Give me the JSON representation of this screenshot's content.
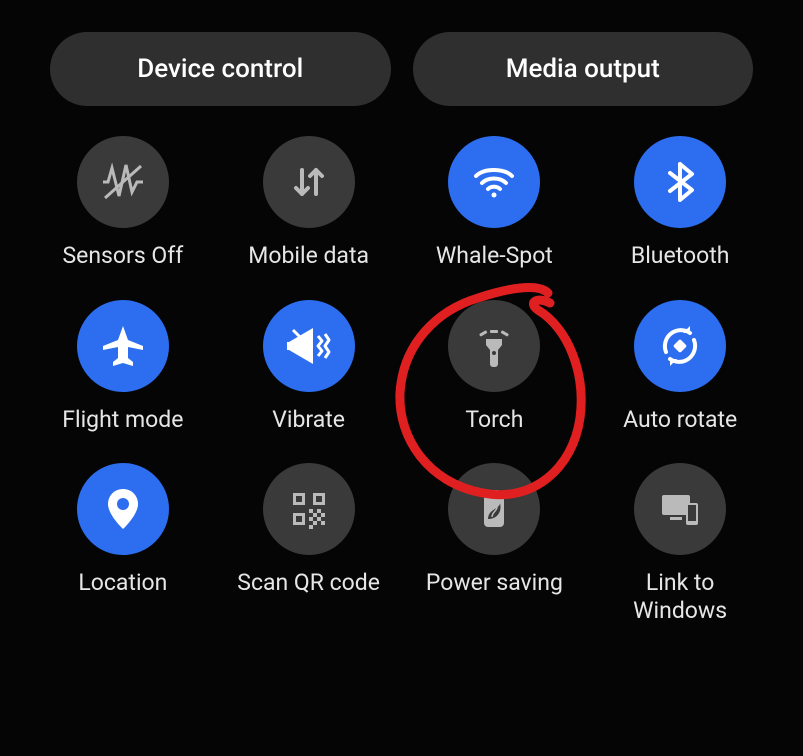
{
  "top": {
    "device_control": "Device control",
    "media_output": "Media output"
  },
  "tiles": {
    "sensors_off": {
      "label": "Sensors Off",
      "on": false
    },
    "mobile_data": {
      "label": "Mobile data",
      "on": false
    },
    "wifi": {
      "label": "Whale-Spot",
      "on": true
    },
    "bluetooth": {
      "label": "Bluetooth",
      "on": true
    },
    "flight_mode": {
      "label": "Flight mode",
      "on": true
    },
    "vibrate": {
      "label": "Vibrate",
      "on": true
    },
    "torch": {
      "label": "Torch",
      "on": false
    },
    "auto_rotate": {
      "label": "Auto rotate",
      "on": true
    },
    "location": {
      "label": "Location",
      "on": true
    },
    "scan_qr": {
      "label": "Scan QR code",
      "on": false
    },
    "power_saving": {
      "label": "Power saving",
      "on": false
    },
    "link_to_windows": {
      "label": "Link to Windows",
      "on": false
    }
  },
  "annotation": {
    "target_tile": "torch",
    "shape": "hand-drawn-circle",
    "color": "#e02020"
  }
}
